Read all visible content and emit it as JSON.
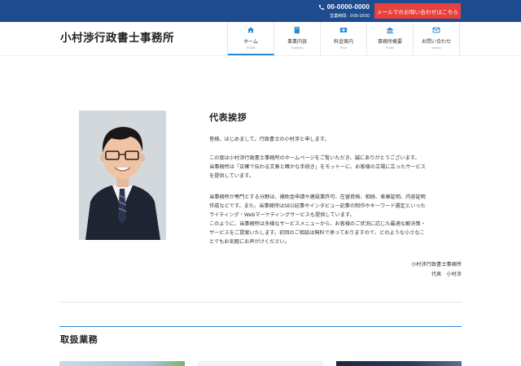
{
  "topbar": {
    "phone": "00-0000-0000",
    "hours": "営業時間：9:00-18:00",
    "cta_label": "メールでのお問い合わせはこちら"
  },
  "header": {
    "site_title": "小村渉行政書士事務所"
  },
  "nav": {
    "items": [
      {
        "label": "ホーム",
        "sub": "HOME",
        "icon": "home-icon"
      },
      {
        "label": "事業内容",
        "sub": "Contents",
        "icon": "book-icon"
      },
      {
        "label": "料金案内",
        "sub": "Price",
        "icon": "money-icon"
      },
      {
        "label": "事務所概要",
        "sub": "Profile",
        "icon": "office-icon"
      },
      {
        "label": "お問い合わせ",
        "sub": "contact",
        "icon": "mail-icon"
      }
    ]
  },
  "greeting": {
    "title": "代表挨拶",
    "p1": [
      "皆様、はじめまして。行政書士の小村渉と申します。"
    ],
    "p2": [
      "この度は小村渉行政書士事務所のホームページをご覧いただき、誠にありがとうございます。",
      "当事務所は「正確で伝わる文章と確かな手続き」をモットーに、お客様の立場に立ったサービス",
      "を提供しています。"
    ],
    "p3": [
      "当事務所が専門とする分野は、補助金申請や建設業許可、在留資格、相続、車庫証明、内容証明",
      "作成などです。また、当事務所はSEO記事やインタビュー記事の制作やキーワード選定といった",
      "ライティング・Webマーケティングサービスも提供しています。",
      "このように、当事務所は多様なサービスメニューから、お客様のご状況に応じた最適な解決策・",
      "サービスをご提案いたします。初回のご相談は無料で承っておりますので、どのような小さなこ",
      "とでもお気軽にお声がけください。"
    ],
    "signature_office": "小村渉行政書士事務所",
    "signature_name": "代表　小村渉"
  },
  "services": {
    "title": "取扱業務"
  },
  "colors": {
    "topbar": "#1e4c8f",
    "cta": "#e8413c",
    "accent": "#2b8ad6"
  }
}
